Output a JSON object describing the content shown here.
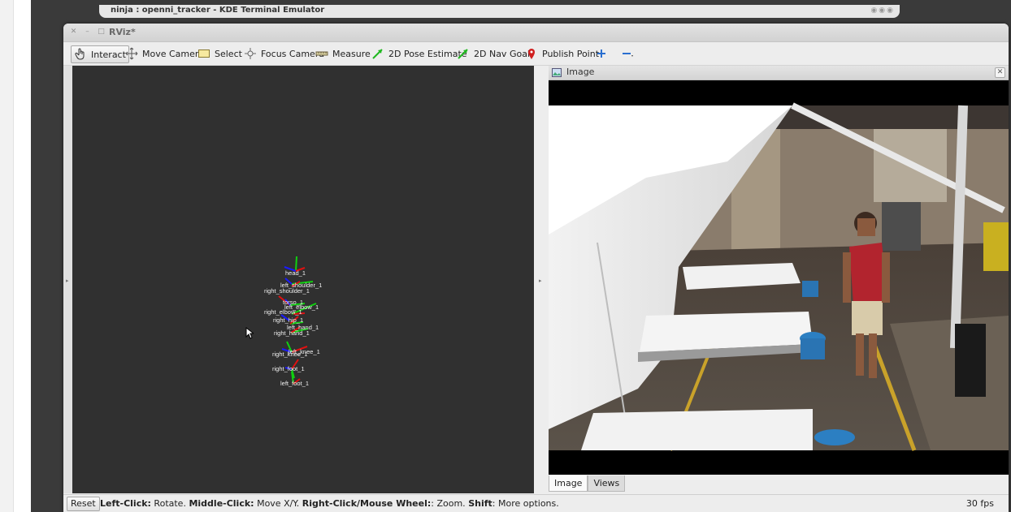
{
  "background_window": {
    "title": "ninja : openni_tracker - KDE Terminal Emulator"
  },
  "window": {
    "title": "RViz*"
  },
  "toolbar": {
    "interact": "Interact",
    "move_camera": "Move Camera",
    "select": "Select",
    "focus_camera": "Focus Camera",
    "measure": "Measure",
    "pose_estimate": "2D Pose Estimate",
    "nav_goal": "2D Nav Goal",
    "publish_point": "Publish Point"
  },
  "skeleton_labels": {
    "head": "head_1",
    "left_shoulder": "left_shoulder_1",
    "right_shoulder": "right_shoulder_1",
    "torso": "torso_1",
    "left_elbow": "left_elbow_1",
    "right_elbow": "right_elbow_1",
    "right_hip": "right_hip_1",
    "left_hand": "left_hand_1",
    "right_hand": "right_hand_1",
    "left_knee": "left_knee_1",
    "right_knee": "right_knee_1",
    "right_foot": "right_foot_1",
    "left_foot": "left_foot_1"
  },
  "image_panel": {
    "title": "Image",
    "tabs": [
      "Image",
      "Views"
    ]
  },
  "status": {
    "reset": "Reset",
    "h1_key": "Left-Click:",
    "h1_val": " Rotate. ",
    "h2_key": "Middle-Click:",
    "h2_val": " Move X/Y. ",
    "h3_key": "Right-Click/Mouse Wheel:",
    "h3_val": ": Zoom. ",
    "h4_key": "Shift",
    "h4_val": ": More options.",
    "fps": "30 fps"
  },
  "colors": {
    "viewport_bg": "#303030",
    "axis_x": "#e01010",
    "axis_y": "#10d010",
    "axis_z": "#1a1aff"
  }
}
